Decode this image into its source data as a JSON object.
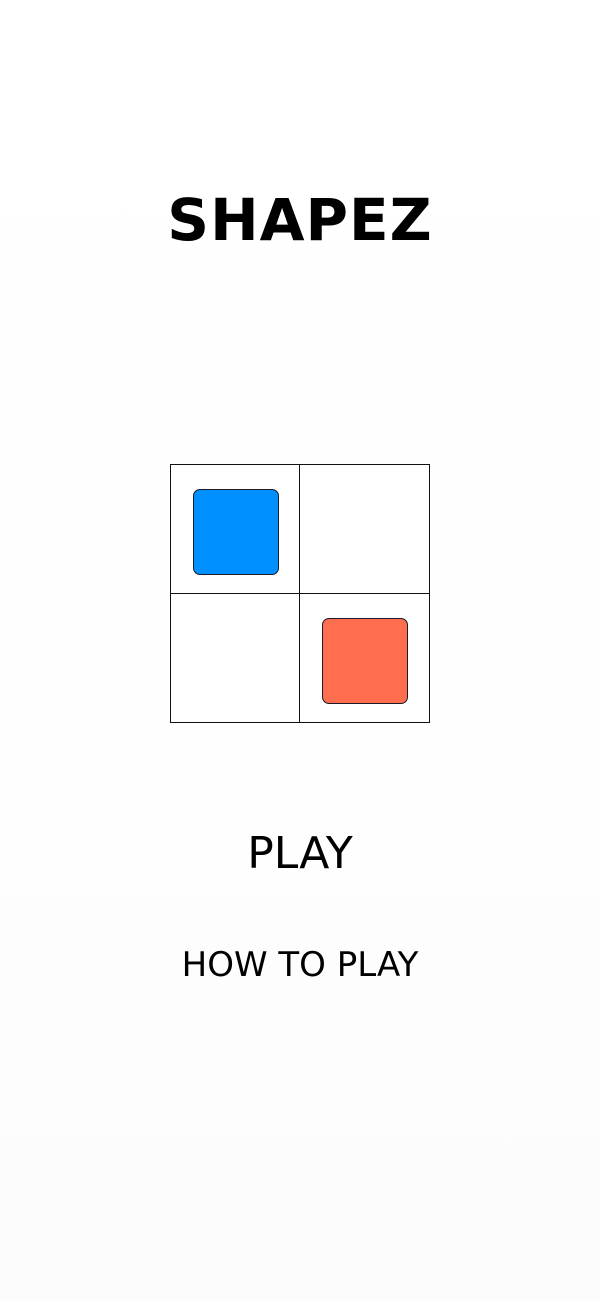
{
  "app": {
    "title": "SHAPEZ"
  },
  "board": {
    "rows": 2,
    "cols": 2,
    "cells": [
      {
        "tile": "square",
        "color": "#0090FF"
      },
      {
        "tile": null
      },
      {
        "tile": null
      },
      {
        "tile": "square",
        "color": "#FF6E4E"
      }
    ]
  },
  "menu": {
    "play_label": "PLAY",
    "how_to_play_label": "HOW TO PLAY"
  },
  "colors": {
    "background": "#FFFFFF",
    "grid_line": "#111111",
    "text": "#000000"
  }
}
